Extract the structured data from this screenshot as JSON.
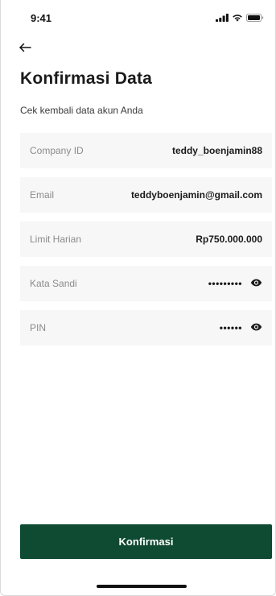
{
  "status_bar": {
    "time": "9:41",
    "signal_icon": "cellular-signal-icon",
    "wifi_icon": "wifi-icon",
    "battery_icon": "battery-icon"
  },
  "header": {
    "back_icon": "arrow-left-icon",
    "title": "Konfirmasi Data",
    "subtitle": "Cek kembali data akun Anda"
  },
  "fields": {
    "company_id": {
      "label": "Company ID",
      "value": "teddy_boenjamin88"
    },
    "email": {
      "label": "Email",
      "value": "teddyboenjamin@gmail.com"
    },
    "limit": {
      "label": "Limit Harian",
      "value": "Rp750.000.000"
    },
    "password": {
      "label": "Kata Sandi",
      "value": "•••••••••",
      "icon": "eye-icon"
    },
    "pin": {
      "label": "PIN",
      "value": "••••••",
      "icon": "eye-icon"
    }
  },
  "actions": {
    "confirm_label": "Konfirmasi"
  },
  "colors": {
    "primary": "#0f4b32",
    "row_background": "#f6f7f6",
    "label_text": "#8b8b8b",
    "value_text": "#1b1b1b"
  }
}
